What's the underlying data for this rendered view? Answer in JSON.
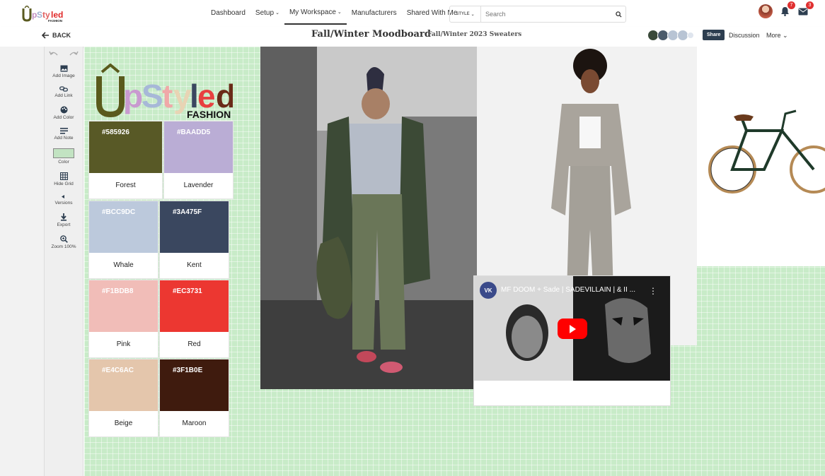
{
  "nav": {
    "logo_text": "UpStyled FASHION",
    "items": [
      {
        "label": "Dashboard",
        "caret": false
      },
      {
        "label": "Setup",
        "caret": true
      },
      {
        "label": "My Workspace",
        "caret": true
      },
      {
        "label": "Manufacturers",
        "caret": false
      },
      {
        "label": "Shared With Me",
        "caret": false
      }
    ],
    "style_select": "STYLE",
    "search_placeholder": "Search",
    "notifications_count": "7",
    "messages_count": "3"
  },
  "subbar": {
    "back_label": "BACK",
    "title": "Fall/Winter Moodboard",
    "subtitle": "Fall/Winter 2023 Sweaters",
    "share_label": "Share",
    "discussion_label": "Discussion",
    "more_label": "More"
  },
  "toolbar": {
    "tools": [
      {
        "label": "Add Image",
        "icon": "image-icon"
      },
      {
        "label": "Add Link",
        "icon": "link-icon"
      },
      {
        "label": "Add Color",
        "icon": "palette-icon"
      },
      {
        "label": "Add Note",
        "icon": "note-icon"
      },
      {
        "label": "Color",
        "icon": "color-swatch-icon"
      },
      {
        "label": "Hide Grid",
        "icon": "grid-icon"
      },
      {
        "label": "Versions",
        "icon": "versions-icon"
      },
      {
        "label": "Export",
        "icon": "download-icon"
      },
      {
        "label": "Zoom 100%",
        "icon": "zoom-icon"
      }
    ],
    "canvas_color": "#c2e3c2"
  },
  "colors": [
    {
      "hex": "#585926",
      "name": "Forest"
    },
    {
      "hex": "#BAADD5",
      "name": "Lavender"
    },
    {
      "hex": "#BCC9DC",
      "name": "Whale"
    },
    {
      "hex": "#3A475F",
      "name": "Kent"
    },
    {
      "hex": "#F1BDB8",
      "name": "Pink"
    },
    {
      "hex": "#EC3731",
      "name": "Red"
    },
    {
      "hex": "#E4C6AC",
      "name": "Beige"
    },
    {
      "hex": "#3F1B0E",
      "name": "Maroon"
    }
  ],
  "video": {
    "title": "MF DOOM + Sade | SADEVILLAIN | & II ..."
  }
}
